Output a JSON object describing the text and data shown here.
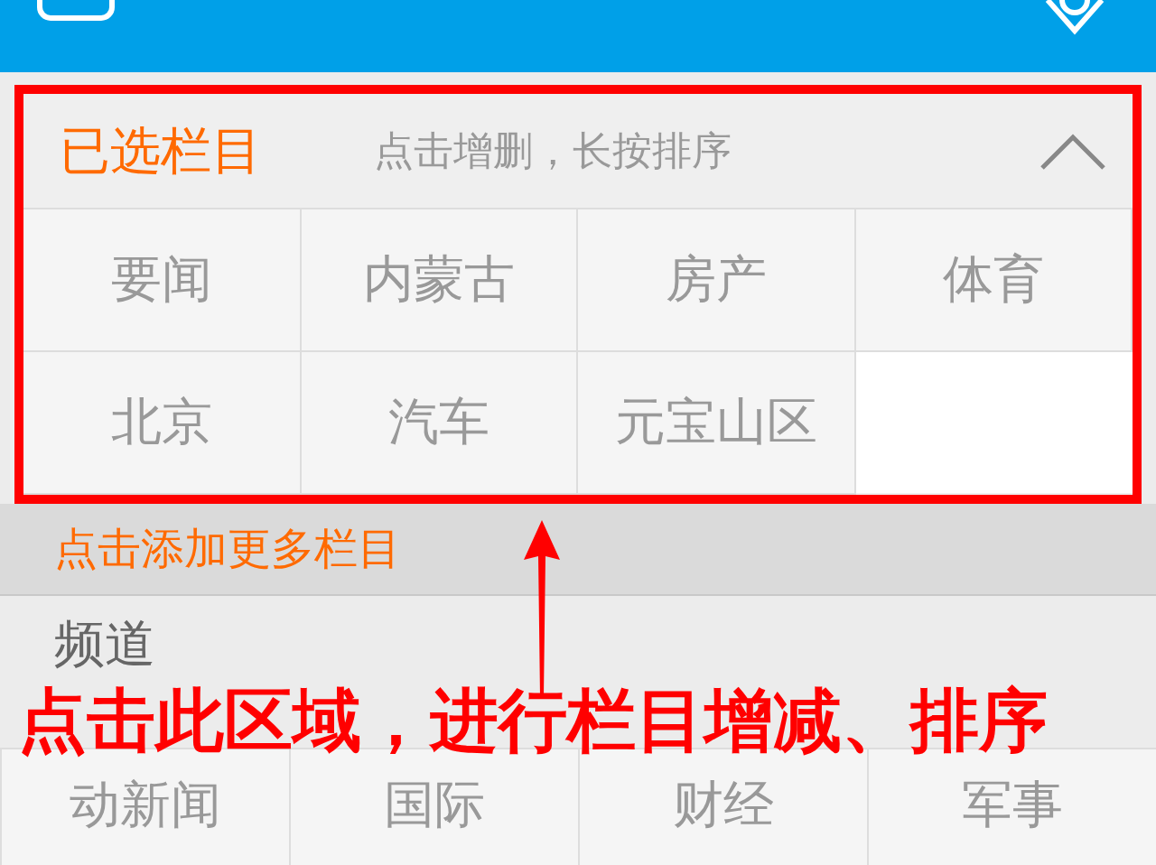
{
  "selected_section": {
    "title": "已选栏目",
    "hint": "点击增删，长按排序",
    "expanded": true,
    "channels": [
      "要闻",
      "内蒙古",
      "房产",
      "体育",
      "北京",
      "汽车",
      "元宝山区"
    ]
  },
  "add_more": "点击添加更多栏目",
  "channel_section": {
    "title": "频道",
    "channels": [
      "动新闻",
      "国际",
      "财经",
      "军事"
    ]
  },
  "annotation": "点击此区域，进行栏目增减、排序"
}
